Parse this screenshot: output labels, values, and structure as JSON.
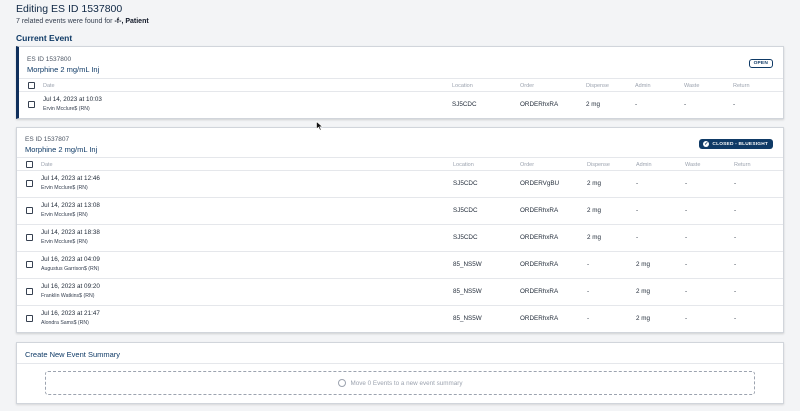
{
  "header": {
    "title": "Editing ES ID 1537800",
    "summary_prefix": "7 related events were found for ",
    "summary_patient": "-f-, Patient",
    "current_section": "Current Event"
  },
  "columns": {
    "date": "Date",
    "location": "Location",
    "order": "Order",
    "dispense": "Dispense",
    "admin": "Admin",
    "waste": "Waste",
    "return": "Return"
  },
  "current_event": {
    "es_id": "ES ID 1537800",
    "drug": "Morphine 2 mg/mL Inj",
    "status": "OPEN",
    "rows": [
      {
        "date": "Jul 14, 2023 at 10:03",
        "user": "Ervin Mcclure$ (RN)",
        "location": "SJ5CDC",
        "order": "ORDERhxRA",
        "dispense": "2 mg",
        "admin": "-",
        "waste": "-",
        "return": "-"
      }
    ]
  },
  "related_event": {
    "es_id": "ES ID 1537807",
    "drug": "Morphine 2 mg/mL Inj",
    "status": "CLOSED - BLUESIGHT",
    "rows": [
      {
        "date": "Jul 14, 2023 at 12:46",
        "user": "Ervin Mcclure$ (RN)",
        "location": "SJ5CDC",
        "order": "ORDERVgBU",
        "dispense": "2 mg",
        "admin": "-",
        "waste": "-",
        "return": "-"
      },
      {
        "date": "Jul 14, 2023 at 13:08",
        "user": "Ervin Mcclure$ (RN)",
        "location": "SJ5CDC",
        "order": "ORDERhxRA",
        "dispense": "2 mg",
        "admin": "-",
        "waste": "-",
        "return": "-"
      },
      {
        "date": "Jul 14, 2023 at 18:38",
        "user": "Ervin Mcclure$ (RN)",
        "location": "SJ5CDC",
        "order": "ORDERhxRA",
        "dispense": "2 mg",
        "admin": "-",
        "waste": "-",
        "return": "-"
      },
      {
        "date": "Jul 16, 2023 at 04:09",
        "user": "Augustus Garrison$ (RN)",
        "location": "85_NS5W",
        "order": "ORDERhxRA",
        "dispense": "-",
        "admin": "2 mg",
        "waste": "-",
        "return": "-"
      },
      {
        "date": "Jul 16, 2023 at 09:20",
        "user": "Franklin Watkins$ (RN)",
        "location": "85_NS5W",
        "order": "ORDERhxRA",
        "dispense": "-",
        "admin": "2 mg",
        "waste": "-",
        "return": "-"
      },
      {
        "date": "Jul 16, 2023 at 21:47",
        "user": "Alondra Sams$ (RN)",
        "location": "85_NS5W",
        "order": "ORDERhxRA",
        "dispense": "-",
        "admin": "2 mg",
        "waste": "-",
        "return": "-"
      }
    ]
  },
  "create_summary": {
    "title": "Create New Event Summary",
    "move_text": "Move 0 Events to a new event summary"
  }
}
